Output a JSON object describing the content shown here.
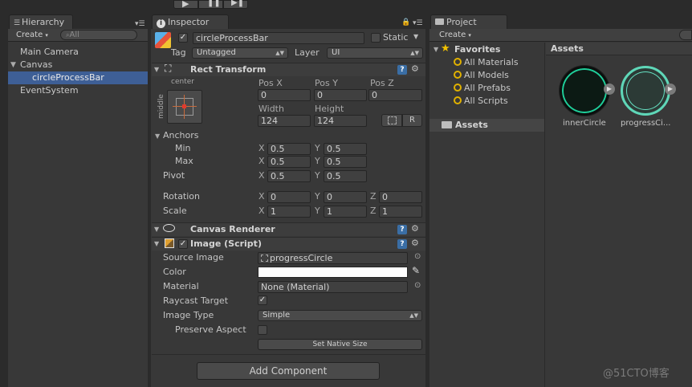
{
  "toolbar": {
    "play_icon": "play-icon",
    "pause_icon": "pause-icon",
    "step_icon": "step-icon"
  },
  "hierarchy": {
    "tab_label": "Hierarchy",
    "create_label": "Create",
    "search_placeholder": "All",
    "items": [
      {
        "label": "Main Camera"
      },
      {
        "label": "Canvas"
      },
      {
        "label": "circleProcessBar"
      },
      {
        "label": "EventSystem"
      }
    ]
  },
  "inspector": {
    "tab_label": "Inspector",
    "object_name": "circleProcessBar",
    "static_label": "Static",
    "tag_label": "Tag",
    "tag_value": "Untagged",
    "layer_label": "Layer",
    "layer_value": "UI",
    "rect_transform": {
      "title": "Rect Transform",
      "anchor_preset_top": "center",
      "anchor_preset_side": "middle",
      "pos_x_label": "Pos X",
      "pos_x": "0",
      "pos_y_label": "Pos Y",
      "pos_y": "0",
      "pos_z_label": "Pos Z",
      "pos_z": "0",
      "width_label": "Width",
      "width": "124",
      "height_label": "Height",
      "height": "124",
      "r_button": "R",
      "anchors_label": "Anchors",
      "min_label": "Min",
      "min_x": "0.5",
      "min_y": "0.5",
      "max_label": "Max",
      "max_x": "0.5",
      "max_y": "0.5",
      "pivot_label": "Pivot",
      "pivot_x": "0.5",
      "pivot_y": "0.5",
      "rotation_label": "Rotation",
      "rot_x": "0",
      "rot_y": "0",
      "rot_z": "0",
      "scale_label": "Scale",
      "scale_x": "1",
      "scale_y": "1",
      "scale_z": "1",
      "x": "X",
      "y": "Y",
      "z": "Z"
    },
    "canvas_renderer": {
      "title": "Canvas Renderer"
    },
    "image": {
      "title": "Image (Script)",
      "source_image_label": "Source Image",
      "source_image": "progressCircle",
      "color_label": "Color",
      "color_value": "#ffffff",
      "material_label": "Material",
      "material_value": "None (Material)",
      "raycast_label": "Raycast Target",
      "image_type_label": "Image Type",
      "image_type": "Simple",
      "preserve_label": "Preserve Aspect",
      "native_size_button": "Set Native Size"
    },
    "add_component": "Add Component"
  },
  "project": {
    "tab_label": "Project",
    "create_label": "Create",
    "favorites_label": "Favorites",
    "favorites": [
      {
        "label": "All Materials"
      },
      {
        "label": "All Models"
      },
      {
        "label": "All Prefabs"
      },
      {
        "label": "All Scripts"
      }
    ],
    "assets_folder": "Assets",
    "assets_header": "Assets",
    "assets": [
      {
        "label": "innerCircle"
      },
      {
        "label": "progressCi..."
      }
    ]
  },
  "watermark": "@51CTO博客"
}
